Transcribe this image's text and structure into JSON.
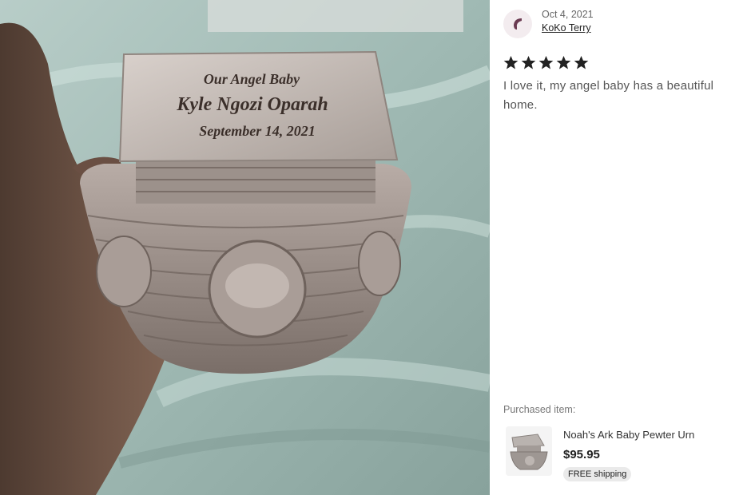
{
  "photo": {
    "plaque_line1": "Our Angel Baby",
    "plaque_line2": "Kyle Ngozi Oparah",
    "plaque_line3": "September 14, 2021"
  },
  "review": {
    "date": "Oct 4, 2021",
    "reviewer": "KoKo Terry",
    "rating": 5,
    "text": "I love it, my angel baby has a beautiful home."
  },
  "purchased": {
    "label": "Purchased item:",
    "title": "Noah's Ark Baby Pewter Urn",
    "price": "$95.95",
    "shipping": "FREE shipping"
  },
  "colors": {
    "star": "#222222",
    "avatar_icon": "#6b3b52",
    "blanket": "#9fb6b1"
  },
  "icons": {
    "avatar": "reviewer-avatar-icon",
    "star": "star-icon"
  }
}
